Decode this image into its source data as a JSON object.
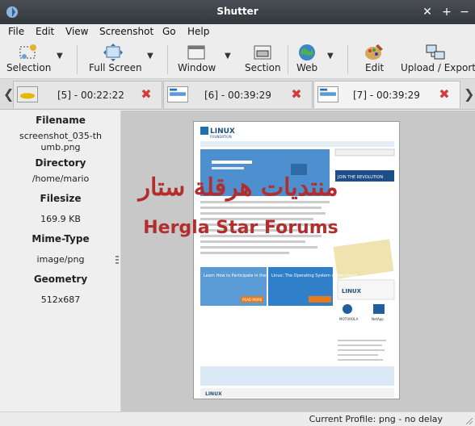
{
  "window": {
    "title": "Shutter"
  },
  "menu": [
    {
      "label": "File"
    },
    {
      "label": "Edit"
    },
    {
      "label": "View"
    },
    {
      "label": "Screenshot"
    },
    {
      "label": "Go"
    },
    {
      "label": "Help"
    }
  ],
  "toolbar": {
    "selection": "Selection",
    "fullscreen": "Full Screen",
    "window": "Window",
    "section": "Section",
    "web": "Web",
    "edit": "Edit",
    "upload": "Upload / Export"
  },
  "tabs": [
    {
      "label": "[5] - 00:22:22"
    },
    {
      "label": "[6] - 00:39:29"
    },
    {
      "label": "[7] - 00:39:29"
    }
  ],
  "info": {
    "filename_h": "Filename",
    "filename_v1": "screenshot_035-th",
    "filename_v2": "umb.png",
    "directory_h": "Directory",
    "directory_v": "/home/mario",
    "filesize_h": "Filesize",
    "filesize_v": "169.9 KB",
    "mime_h": "Mime-Type",
    "mime_v": "image/png",
    "geometry_h": "Geometry",
    "geometry_v": "512x687"
  },
  "preview": {
    "site_logo": "LINUX",
    "site_logo_sub": "FOUNDATION",
    "promo1": "Learn How to Participate in the Linux Community",
    "promo2": "Linux: The Operating System of the Cloud",
    "read_more": "READ MORE",
    "join": "JOIN THE REVOLUTION",
    "partner1": "MOTOROLA",
    "partner2": "NetApp"
  },
  "watermark": {
    "arabic": "منتديات هرقلة ستار",
    "latin": "Hergla Star Forums"
  },
  "status": {
    "profile": "Current Profile: png - no delay"
  },
  "colors": {
    "titlebar": "#3d4247",
    "accent_blue": "#1f6fb2",
    "close_red": "#d23c3c",
    "watermark": "#b32d2d"
  }
}
